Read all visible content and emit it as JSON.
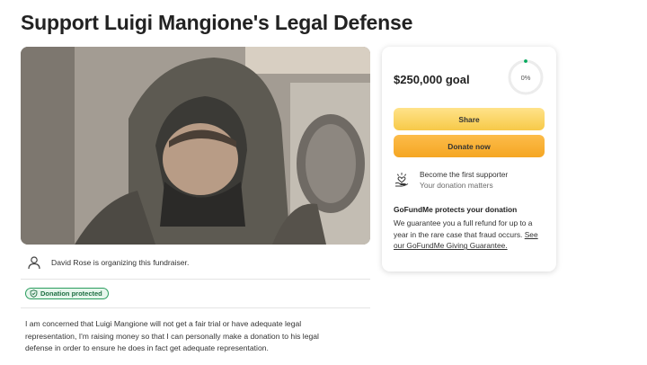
{
  "page": {
    "title": "Support Luigi Mangione's Legal Defense"
  },
  "organizer": {
    "text": "David Rose is organizing this fundraiser."
  },
  "badge": {
    "label": "Donation protected",
    "color": "#2b9d5f"
  },
  "story": {
    "text": "I am concerned that Luigi Mangione will not get a fair trial or have adequate legal representation, I'm raising money so that I can personally make a donation to his legal defense in order to ensure he does in fact get adequate representation."
  },
  "card": {
    "goal": "$250,000 goal",
    "progress_percent": 0,
    "progress_label": "0%",
    "share_label": "Share",
    "donate_label": "Donate now",
    "supporter_title": "Become the first supporter",
    "supporter_sub": "Your donation matters",
    "protect_heading": "GoFundMe protects your donation",
    "protect_text": "We guarantee you a full refund for up to a year in the rare case that fraud occurs.",
    "protect_link": "See our GoFundMe Giving Guarantee.",
    "accent": "#02a95c",
    "share_color": "#f7c948",
    "donate_color": "#f5a623"
  },
  "icons": {
    "organizer": "user-icon",
    "badge": "shield-icon",
    "supporter": "heart-hand-icon"
  }
}
